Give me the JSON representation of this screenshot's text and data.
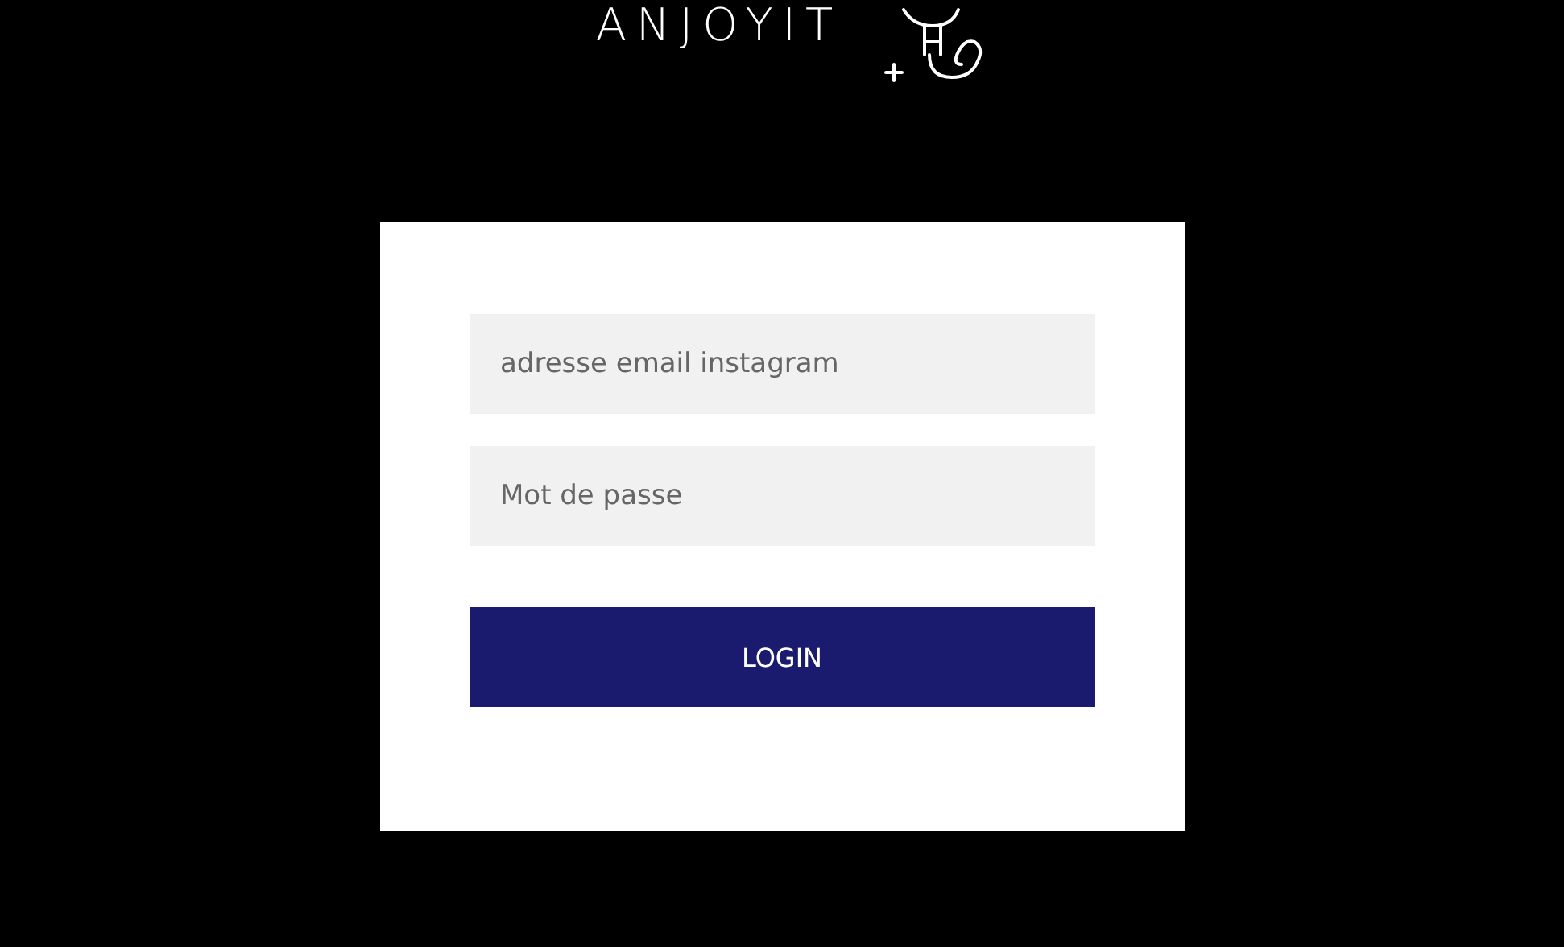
{
  "logo": {
    "text": "ANJOYIT"
  },
  "form": {
    "email": {
      "placeholder": "adresse email instagram"
    },
    "password": {
      "placeholder": "Mot de passe"
    },
    "button": "LOGIN"
  }
}
